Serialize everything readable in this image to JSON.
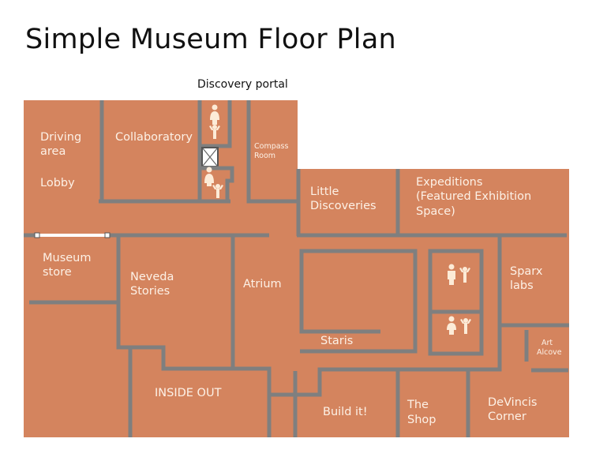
{
  "title": "Simple Museum Floor Plan",
  "portal_label": "Discovery portal",
  "colors": {
    "floor": "#d4845e",
    "wall": "#7f7f7f",
    "label": "#fdf1e6",
    "title": "#111111"
  },
  "rooms": [
    {
      "id": "driving-area",
      "lines": [
        "Driving",
        "area"
      ]
    },
    {
      "id": "lobby",
      "lines": [
        "Lobby"
      ]
    },
    {
      "id": "collaboratory",
      "lines": [
        "Collaboratory"
      ]
    },
    {
      "id": "compass-room",
      "lines": [
        "Compass",
        "Room"
      ]
    },
    {
      "id": "little-discoveries",
      "lines": [
        "Little",
        "Discoveries"
      ]
    },
    {
      "id": "expeditions",
      "lines": [
        "Expeditions",
        "(Featured Exhibition",
        "Space)"
      ]
    },
    {
      "id": "museum-store",
      "lines": [
        "Museum",
        "store"
      ]
    },
    {
      "id": "neveda-stories",
      "lines": [
        "Neveda",
        "Stories"
      ]
    },
    {
      "id": "atrium",
      "lines": [
        "Atrium"
      ]
    },
    {
      "id": "staris",
      "lines": [
        "Staris"
      ]
    },
    {
      "id": "sparx-labs",
      "lines": [
        "Sparx",
        "labs"
      ]
    },
    {
      "id": "art-alcove",
      "lines": [
        "Art",
        "Alcove"
      ]
    },
    {
      "id": "inside-out",
      "lines": [
        "INSIDE OUT"
      ]
    },
    {
      "id": "build-it",
      "lines": [
        "Build it!"
      ]
    },
    {
      "id": "the-shop",
      "lines": [
        "The",
        "Shop"
      ]
    },
    {
      "id": "devincis-corner",
      "lines": [
        "DeVincis",
        "Corner"
      ]
    }
  ],
  "icons": [
    {
      "id": "restroom-top",
      "type": "restroom-icon"
    },
    {
      "id": "elevator",
      "type": "elevator-icon"
    },
    {
      "id": "restroom-bottom",
      "type": "restroom-icon"
    },
    {
      "id": "restroom-mid-upper",
      "type": "restroom-icon"
    },
    {
      "id": "restroom-mid-lower",
      "type": "restroom-icon"
    }
  ]
}
